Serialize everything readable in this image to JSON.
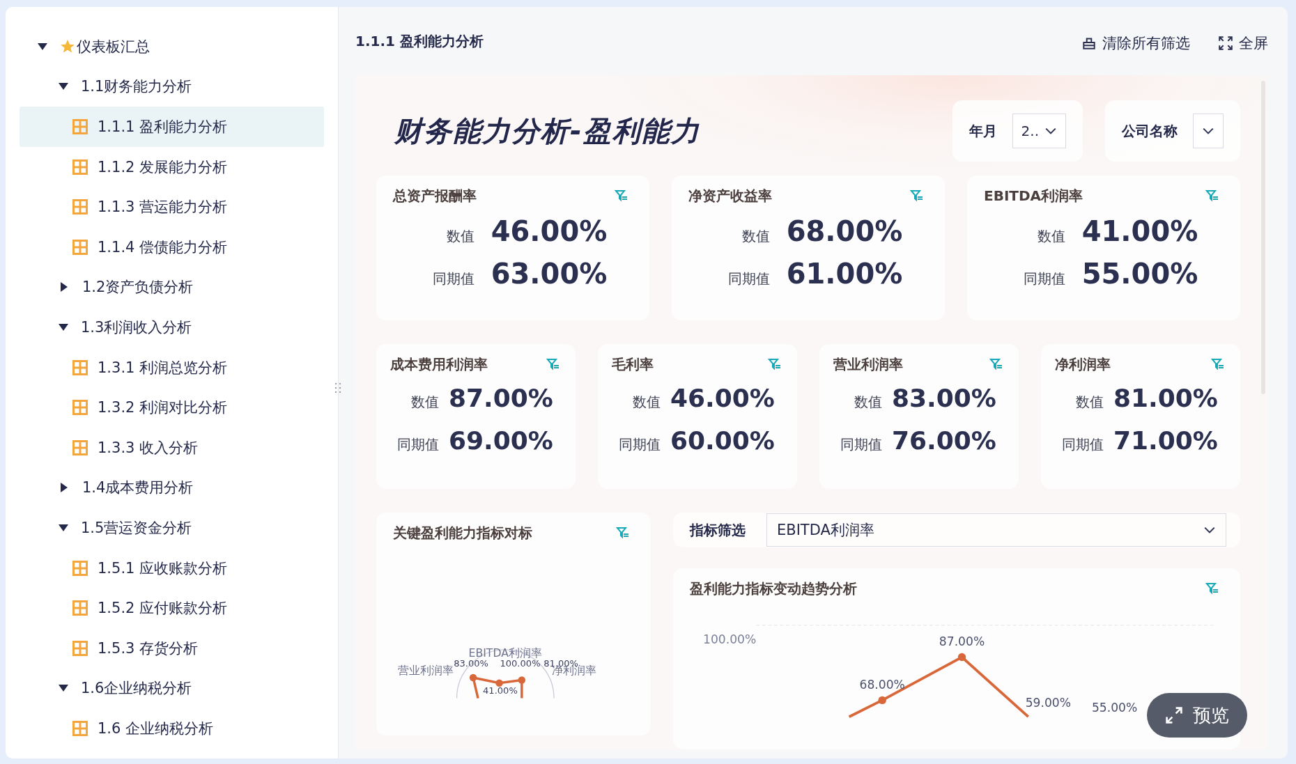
{
  "sidebar": {
    "tree": [
      {
        "label": "仪表板汇总",
        "kind": "root",
        "expanded": true,
        "children": [
          {
            "label": "1.1财务能力分析",
            "kind": "group",
            "expanded": true,
            "children": [
              {
                "label": "1.1.1 盈利能力分析",
                "kind": "page",
                "selected": true
              },
              {
                "label": "1.1.2 发展能力分析",
                "kind": "page",
                "selected": false
              },
              {
                "label": "1.1.3 营运能力分析",
                "kind": "page",
                "selected": false
              },
              {
                "label": "1.1.4 偿债能力分析",
                "kind": "page",
                "selected": false
              }
            ]
          },
          {
            "label": "1.2资产负债分析",
            "kind": "group",
            "expanded": false
          },
          {
            "label": "1.3利润收入分析",
            "kind": "group",
            "expanded": true,
            "children": [
              {
                "label": "1.3.1 利润总览分析",
                "kind": "page",
                "selected": false
              },
              {
                "label": "1.3.2 利润对比分析",
                "kind": "page",
                "selected": false
              },
              {
                "label": "1.3.3 收入分析",
                "kind": "page",
                "selected": false
              }
            ]
          },
          {
            "label": "1.4成本费用分析",
            "kind": "group",
            "expanded": false
          },
          {
            "label": "1.5营运资金分析",
            "kind": "group",
            "expanded": true,
            "children": [
              {
                "label": "1.5.1 应收账款分析",
                "kind": "page",
                "selected": false
              },
              {
                "label": "1.5.2 应付账款分析",
                "kind": "page",
                "selected": false
              },
              {
                "label": "1.5.3 存货分析",
                "kind": "page",
                "selected": false
              }
            ]
          },
          {
            "label": "1.6企业纳税分析",
            "kind": "group",
            "expanded": true,
            "children": [
              {
                "label": "1.6 企业纳税分析",
                "kind": "page",
                "selected": false
              }
            ]
          }
        ]
      }
    ]
  },
  "header": {
    "title": "1.1.1 盈利能力分析",
    "actions": [
      {
        "label": "清除所有筛选",
        "kind": "clear"
      },
      {
        "label": "全屏",
        "kind": "fullscreen"
      }
    ]
  },
  "dashboard": {
    "title": "财务能力分析-盈利能力",
    "filters": [
      {
        "label": "年月",
        "value": "2.."
      },
      {
        "label": "公司名称"
      }
    ],
    "kpi_rows": [
      [
        {
          "title": "总资产报酬率",
          "value_label": "数值",
          "value": "46.00%",
          "prior_label": "同期值",
          "prior": "63.00%"
        },
        {
          "title": "净资产收益率",
          "value_label": "数值",
          "value": "68.00%",
          "prior_label": "同期值",
          "prior": "61.00%"
        },
        {
          "title": "EBITDA利润率",
          "value_label": "数值",
          "value": "41.00%",
          "prior_label": "同期值",
          "prior": "55.00%"
        }
      ],
      [
        {
          "title": "成本费用利润率",
          "value_label": "数值",
          "value": "87.00%",
          "prior_label": "同期值",
          "prior": "69.00%"
        },
        {
          "title": "毛利率",
          "value_label": "数值",
          "value": "46.00%",
          "prior_label": "同期值",
          "prior": "60.00%"
        },
        {
          "title": "营业利润率",
          "value_label": "数值",
          "value": "83.00%",
          "prior_label": "同期值",
          "prior": "76.00%"
        },
        {
          "title": "净利润率",
          "value_label": "数值",
          "value": "81.00%",
          "prior_label": "同期值",
          "prior": "71.00%"
        }
      ]
    ],
    "benchmark": {
      "title": "关键盈利能力指标对标",
      "axis_labels": [
        "EBITDA利润率",
        "营业利润率",
        "净利润率"
      ],
      "value_labels": [
        "83.00%",
        "41.00%",
        "81.00%"
      ],
      "scale_label": "100.00%"
    },
    "indicator_filter": {
      "label": "指标筛选",
      "value": "EBITDA利润率"
    },
    "trend": {
      "title": "盈利能力指标变动趋势分析",
      "y_label": "100.00%",
      "point_labels": [
        "68.00%",
        "87.00%",
        "59.00%",
        "55.00%"
      ]
    },
    "preview_button": "预览"
  }
}
